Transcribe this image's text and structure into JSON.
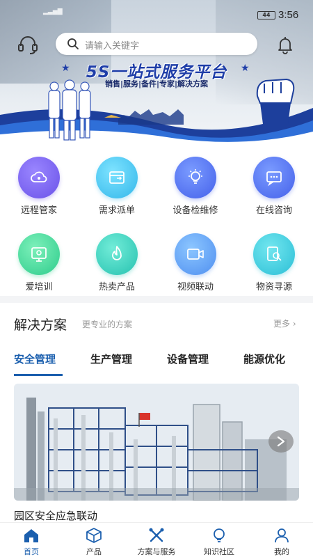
{
  "status_bar": {
    "time": "3:56",
    "battery": "44"
  },
  "search": {
    "placeholder": "请输入关键字"
  },
  "hero": {
    "title": "5S一站式服务平台",
    "subtitle": "销售|服务|备件|专家|解决方案"
  },
  "services": [
    {
      "label": "远程管家",
      "icon": "cloud-icon"
    },
    {
      "label": "需求派单",
      "icon": "dispatch-icon"
    },
    {
      "label": "设备检维修",
      "icon": "lightbulb-icon"
    },
    {
      "label": "在线咨询",
      "icon": "chat-icon"
    },
    {
      "label": "爱培训",
      "icon": "training-icon"
    },
    {
      "label": "热卖产品",
      "icon": "flame-icon"
    },
    {
      "label": "视频联动",
      "icon": "video-icon"
    },
    {
      "label": "物资寻源",
      "icon": "search-doc-icon"
    }
  ],
  "solutions": {
    "title": "解决方案",
    "subtitle": "更专业的方案",
    "more": "更多 ›",
    "tabs": [
      "安全管理",
      "生产管理",
      "设备管理",
      "能源优化"
    ],
    "active_tab": 0,
    "caption": "园区安全应急联动"
  },
  "nav": {
    "items": [
      {
        "label": "首页",
        "icon": "home-icon"
      },
      {
        "label": "产品",
        "icon": "cube-icon"
      },
      {
        "label": "方案与服务",
        "icon": "tools-icon"
      },
      {
        "label": "知识社区",
        "icon": "bulb-icon"
      },
      {
        "label": "我的",
        "icon": "user-icon"
      }
    ],
    "active_index": 0
  },
  "colors": {
    "brand": "#1b5fae",
    "hero_title": "#1f3ea8"
  }
}
